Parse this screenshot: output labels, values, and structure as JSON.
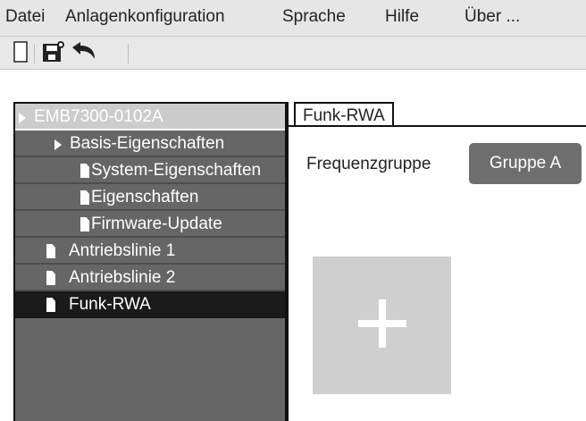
{
  "menu": {
    "items": [
      {
        "label": "Datei"
      },
      {
        "label": "Anlagenkonfiguration"
      },
      {
        "label": "Sprache"
      },
      {
        "label": "Hilfe"
      },
      {
        "label": "Über ..."
      }
    ]
  },
  "toolbar": {
    "icons": [
      "new-document-icon",
      "save-icon",
      "undo-icon"
    ]
  },
  "tree": {
    "items": [
      {
        "label": "EMB7300-0102A",
        "icon": "chevron-right-icon"
      },
      {
        "label": "Basis-Eigenschaften",
        "icon": "chevron-right-icon"
      },
      {
        "label": "System-Eigenschaften",
        "icon": "document-icon"
      },
      {
        "label": "Eigenschaften",
        "icon": "document-icon"
      },
      {
        "label": "Firmware-Update",
        "icon": "document-icon"
      },
      {
        "label": "Antriebslinie 1",
        "icon": "document-icon"
      },
      {
        "label": "Antriebslinie 2",
        "icon": "document-icon"
      },
      {
        "label": "Funk-RWA",
        "icon": "document-icon",
        "selected": true
      }
    ]
  },
  "main": {
    "tab_label": "Funk-RWA",
    "freq_label": "Frequenzgruppe",
    "group_button": "Gruppe A",
    "add_icon": "plus-icon"
  },
  "colors": {
    "tree_bg": "#666666",
    "tree_root_bg": "#cccccc",
    "tree_selected_bg": "#1a1a1a",
    "button_bg": "#6e6e6e",
    "add_tile_bg": "#cfcfcf"
  }
}
